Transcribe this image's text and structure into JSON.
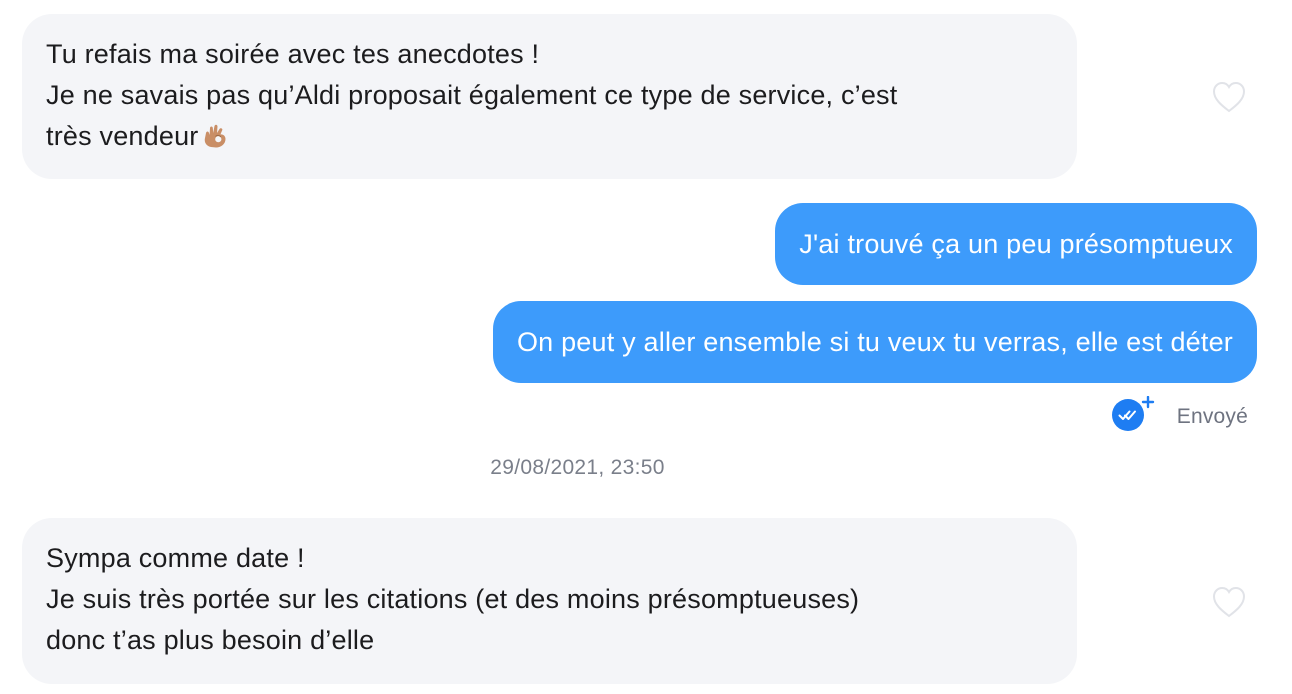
{
  "messages": [
    {
      "direction": "received",
      "lines": [
        "Tu refais ma soirée avec tes anecdotes !",
        "Je ne savais pas qu’Aldi proposait également ce type de service, c’est",
        "très vendeur"
      ],
      "emoji": "ok-hand-emoji",
      "liked": false
    },
    {
      "direction": "sent",
      "text": "J'ai trouvé ça un peu présomptueux"
    },
    {
      "direction": "sent",
      "text": "On peut y aller ensemble si tu veux tu verras, elle est déter"
    },
    {
      "direction": "received",
      "lines": [
        "Sympa comme date !",
        "Je suis très portée sur les citations (et des moins présomptueuses)",
        "donc t’as plus besoin d’elle"
      ],
      "liked": false
    }
  ],
  "status": {
    "label": "Envoyé",
    "icon": "double-check-plus-icon"
  },
  "timestamp": "29/08/2021, 23:50",
  "colors": {
    "sent_bubble": "#3d9bfb",
    "received_bubble": "#f4f5f8",
    "status_icon": "#1e7df2",
    "meta_text": "#7a7f8a",
    "heart_outline": "#e1e3e8"
  }
}
